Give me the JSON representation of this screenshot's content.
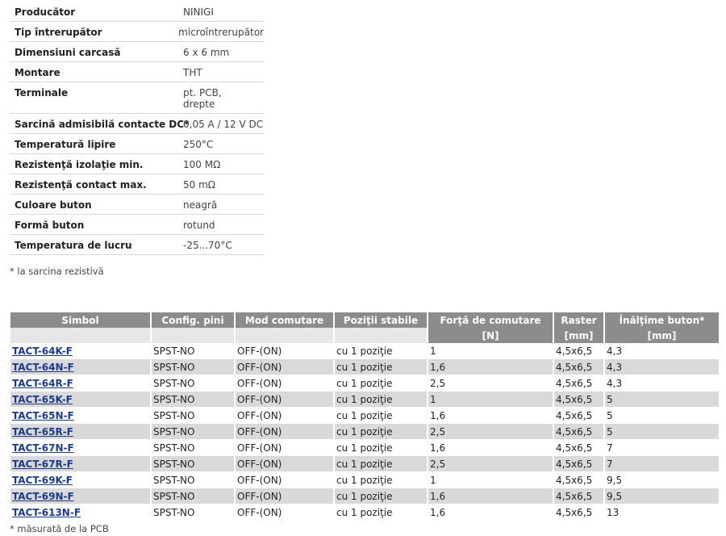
{
  "specs": [
    {
      "label": "Producător",
      "value": [
        "NINIGI"
      ]
    },
    {
      "label": "Tip întrerupător",
      "value": [
        "microîntrerupător"
      ]
    },
    {
      "label": "Dimensiuni carcasă",
      "value": [
        "6 x 6 mm"
      ]
    },
    {
      "label": "Montare",
      "value": [
        "THT"
      ]
    },
    {
      "label": "Terminale",
      "value": [
        "pt. PCB,",
        "drepte"
      ]
    },
    {
      "label": "Sarcină admisibilă contacte DC*",
      "value": [
        "0,05 A / 12 V DC"
      ]
    },
    {
      "label": "Temperatură lipire",
      "value": [
        "250°C"
      ]
    },
    {
      "label": "Rezistenţă izolaţie min.",
      "value": [
        "100 MΩ"
      ]
    },
    {
      "label": "Rezistenţă contact max.",
      "value": [
        "50 mΩ"
      ]
    },
    {
      "label": "Culoare buton",
      "value": [
        "neagră"
      ]
    },
    {
      "label": "Formă buton",
      "value": [
        "rotund"
      ]
    },
    {
      "label": "Temperatura de lucru",
      "value": [
        "-25...70°C"
      ]
    }
  ],
  "spec_note": "* la sarcina rezistivă",
  "table": {
    "headers": [
      "Simbol",
      "Config. pini",
      "Mod comutare",
      "Poziţii stabile",
      "Forţă de comutare",
      "Raster",
      "Înălţime buton*"
    ],
    "units": [
      "",
      "",
      "",
      "",
      "[N]",
      "[mm]",
      "[mm]"
    ],
    "rows": [
      [
        "TACT-64K-F",
        "SPST-NO",
        "OFF-(ON)",
        "cu 1 poziţie",
        "1",
        "4,5x6,5",
        "4,3"
      ],
      [
        "TACT-64N-F",
        "SPST-NO",
        "OFF-(ON)",
        "cu 1 poziţie",
        "1,6",
        "4,5x6,5",
        "4,3"
      ],
      [
        "TACT-64R-F",
        "SPST-NO",
        "OFF-(ON)",
        "cu 1 poziţie",
        "2,5",
        "4,5x6,5",
        "4,3"
      ],
      [
        "TACT-65K-F",
        "SPST-NO",
        "OFF-(ON)",
        "cu 1 poziţie",
        "1",
        "4,5x6,5",
        "5"
      ],
      [
        "TACT-65N-F",
        "SPST-NO",
        "OFF-(ON)",
        "cu 1 poziţie",
        "1,6",
        "4,5x6,5",
        "5"
      ],
      [
        "TACT-65R-F",
        "SPST-NO",
        "OFF-(ON)",
        "cu 1 poziţie",
        "2,5",
        "4,5x6,5",
        "5"
      ],
      [
        "TACT-67N-F",
        "SPST-NO",
        "OFF-(ON)",
        "cu 1 poziţie",
        "1,6",
        "4,5x6,5",
        "7"
      ],
      [
        "TACT-67R-F",
        "SPST-NO",
        "OFF-(ON)",
        "cu 1 poziţie",
        "2,5",
        "4,5x6,5",
        "7"
      ],
      [
        "TACT-69K-F",
        "SPST-NO",
        "OFF-(ON)",
        "cu 1 poziţie",
        "1",
        "4,5x6,5",
        "9,5"
      ],
      [
        "TACT-69N-F",
        "SPST-NO",
        "OFF-(ON)",
        "cu 1 poziţie",
        "1,6",
        "4,5x6,5",
        "9,5"
      ],
      [
        "TACT-613N-F",
        "SPST-NO",
        "OFF-(ON)",
        "cu 1 poziţie",
        "1,6",
        "4,5x6,5",
        "13"
      ]
    ]
  },
  "table_note": "* măsurată de la PCB",
  "colors": {
    "header_bg": "#8c8c8c",
    "row_alt_bg": "#d9d9d9",
    "link": "#1c3a8a"
  }
}
